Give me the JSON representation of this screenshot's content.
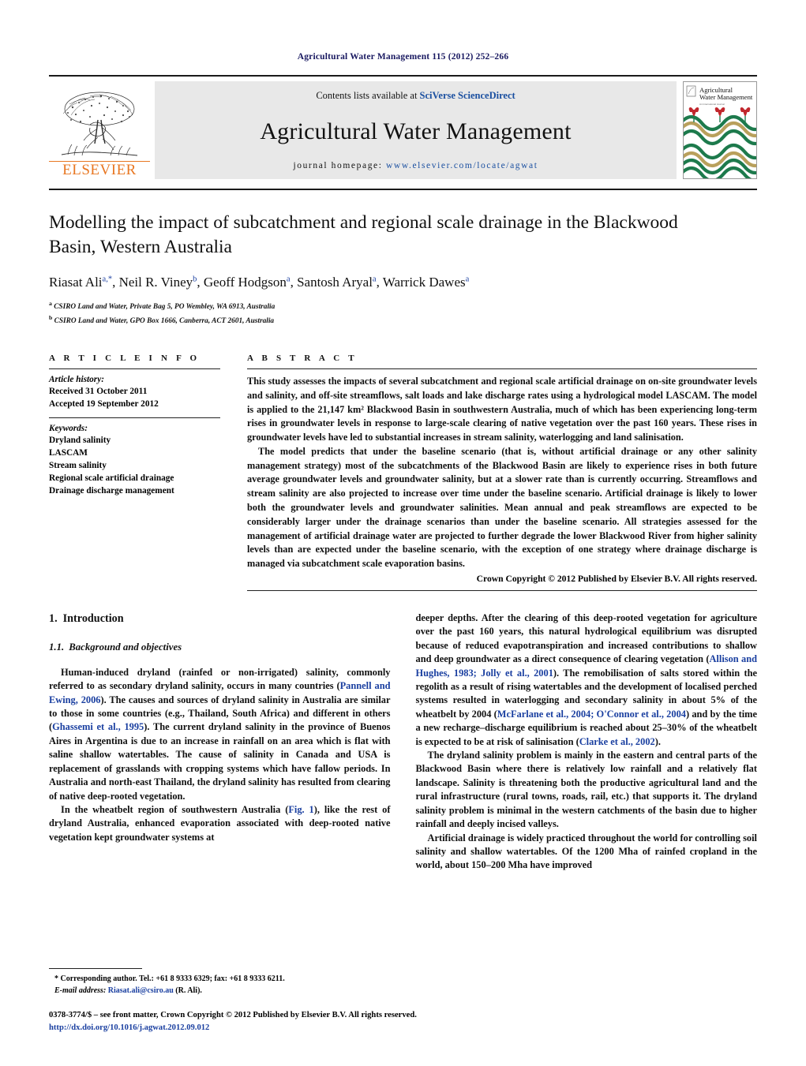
{
  "running_head": "Agricultural Water Management 115 (2012) 252–266",
  "masthead": {
    "contents_prefix": "Contents lists available at ",
    "sciverse_link": "SciVerse ScienceDirect",
    "journal_title": "Agricultural Water Management",
    "homepage_prefix": "journal homepage: ",
    "homepage_url": "www.elsevier.com/locate/agwat",
    "publisher_name": "ELSEVIER",
    "cover_title_line1": "Agricultural",
    "cover_title_line2": "Water Management",
    "accent_orange": "#E87722",
    "link_blue": "#1a4fa0",
    "panel_gray": "#e8e8e8"
  },
  "article": {
    "title": "Modelling the impact of subcatchment and regional scale drainage in the Blackwood Basin, Western Australia",
    "authors_html": "Riasat Ali<sup>a,*</sup>, Neil R. Viney<sup>b</sup>, Geoff Hodgson<sup>a</sup>, Santosh Aryal<sup>a</sup>, Warrick Dawes<sup>a</sup>",
    "affiliations": [
      "CSIRO Land and Water, Private Bag 5, PO Wembley, WA 6913, Australia",
      "CSIRO Land and Water, GPO Box 1666, Canberra, ACT 2601, Australia"
    ],
    "affiliation_markers": [
      "a",
      "b"
    ]
  },
  "article_info": {
    "heading": "A R T I C L E   I N F O",
    "history_label": "Article history:",
    "history": [
      "Received 31 October 2011",
      "Accepted 19 September 2012"
    ],
    "keywords_label": "Keywords:",
    "keywords": [
      "Dryland salinity",
      "LASCAM",
      "Stream salinity",
      "Regional scale artificial drainage",
      "Drainage discharge management"
    ]
  },
  "abstract": {
    "heading": "A B S T R A C T",
    "paragraphs": [
      "This study assesses the impacts of several subcatchment and regional scale artificial drainage on on-site groundwater levels and salinity, and off-site streamflows, salt loads and lake discharge rates using a hydrological model LASCAM. The model is applied to the 21,147 km² Blackwood Basin in southwestern Australia, much of which has been experiencing long-term rises in groundwater levels in response to large-scale clearing of native vegetation over the past 160 years. These rises in groundwater levels have led to substantial increases in stream salinity, waterlogging and land salinisation.",
      "The model predicts that under the baseline scenario (that is, without artificial drainage or any other salinity management strategy) most of the subcatchments of the Blackwood Basin are likely to experience rises in both future average groundwater levels and groundwater salinity, but at a slower rate than is currently occurring. Streamflows and stream salinity are also projected to increase over time under the baseline scenario. Artificial drainage is likely to lower both the groundwater levels and groundwater salinities. Mean annual and peak streamflows are expected to be considerably larger under the drainage scenarios than under the baseline scenario. All strategies assessed for the management of artificial drainage water are projected to further degrade the lower Blackwood River from higher salinity levels than are expected under the baseline scenario, with the exception of one strategy where drainage discharge is managed via subcatchment scale evaporation basins."
    ],
    "copyright": "Crown Copyright © 2012 Published by Elsevier B.V. All rights reserved."
  },
  "introduction": {
    "section_number": "1.",
    "section_title": "Introduction",
    "subsection_number": "1.1.",
    "subsection_title": "Background and objectives",
    "left_column": [
      {
        "indent": true,
        "parts": [
          {
            "t": "Human-induced dryland (rainfed or non-irrigated) salinity, commonly referred to as secondary dryland salinity, occurs in many countries ("
          },
          {
            "t": "Pannell and Ewing, 2006",
            "cite": true
          },
          {
            "t": "). The causes and sources of dryland salinity in Australia are similar to those in some countries (e.g., Thailand, South Africa) and different in others ("
          },
          {
            "t": "Ghassemi et al., 1995",
            "cite": true
          },
          {
            "t": "). The current dryland salinity in the province of Buenos Aires in Argentina is due to an increase in rainfall on an area which is flat with saline shallow watertables. The cause of salinity in Canada and USA is replacement of grasslands with cropping systems which have fallow periods. In Australia and north-east Thailand, the dryland salinity has resulted from clearing of native deep-rooted vegetation."
          }
        ]
      },
      {
        "indent": true,
        "parts": [
          {
            "t": "In the wheatbelt region of southwestern Australia ("
          },
          {
            "t": "Fig. 1",
            "cite": true
          },
          {
            "t": "), like the rest of dryland Australia, enhanced evaporation associated with deep-rooted native vegetation kept groundwater systems at"
          }
        ]
      }
    ],
    "right_column": [
      {
        "indent": false,
        "parts": [
          {
            "t": "deeper depths. After the clearing of this deep-rooted vegetation for agriculture over the past 160 years, this natural hydrological equilibrium was disrupted because of reduced evapotranspiration and increased contributions to shallow and deep groundwater as a direct consequence of clearing vegetation ("
          },
          {
            "t": "Allison and Hughes, 1983; Jolly et al., 2001",
            "cite": true
          },
          {
            "t": "). The remobilisation of salts stored within the regolith as a result of rising watertables and the development of localised perched systems resulted in waterlogging and secondary salinity in about 5% of the wheatbelt by 2004 ("
          },
          {
            "t": "McFarlane et al., 2004; O'Connor et al., 2004",
            "cite": true
          },
          {
            "t": ") and by the time a new recharge–discharge equilibrium is reached about 25–30% of the wheatbelt is expected to be at risk of salinisation ("
          },
          {
            "t": "Clarke et al., 2002",
            "cite": true
          },
          {
            "t": ")."
          }
        ]
      },
      {
        "indent": true,
        "parts": [
          {
            "t": "The dryland salinity problem is mainly in the eastern and central parts of the Blackwood Basin where there is relatively low rainfall and a relatively flat landscape. Salinity is threatening both the productive agricultural land and the rural infrastructure (rural towns, roads, rail, etc.) that supports it. The dryland salinity problem is minimal in the western catchments of the basin due to higher rainfall and deeply incised valleys."
          }
        ]
      },
      {
        "indent": true,
        "parts": [
          {
            "t": "Artificial drainage is widely practiced throughout the world for controlling soil salinity and shallow watertables. Of the 1200 Mha of rainfed cropland in the world, about 150–200 Mha have improved"
          }
        ]
      }
    ]
  },
  "footnotes": {
    "corresponding": "* Corresponding author. Tel.: +61 8 9333 6329; fax: +61 8 9333 6211.",
    "email_label": "E-mail address:",
    "email_link": "Riasat.ali@csiro.au",
    "email_suffix": "(R. Ali)."
  },
  "footer": {
    "issn_line": "0378-3774/$ – see front matter, Crown Copyright © 2012 Published by Elsevier B.V. All rights reserved.",
    "doi": "http://dx.doi.org/10.1016/j.agwat.2012.09.012"
  }
}
